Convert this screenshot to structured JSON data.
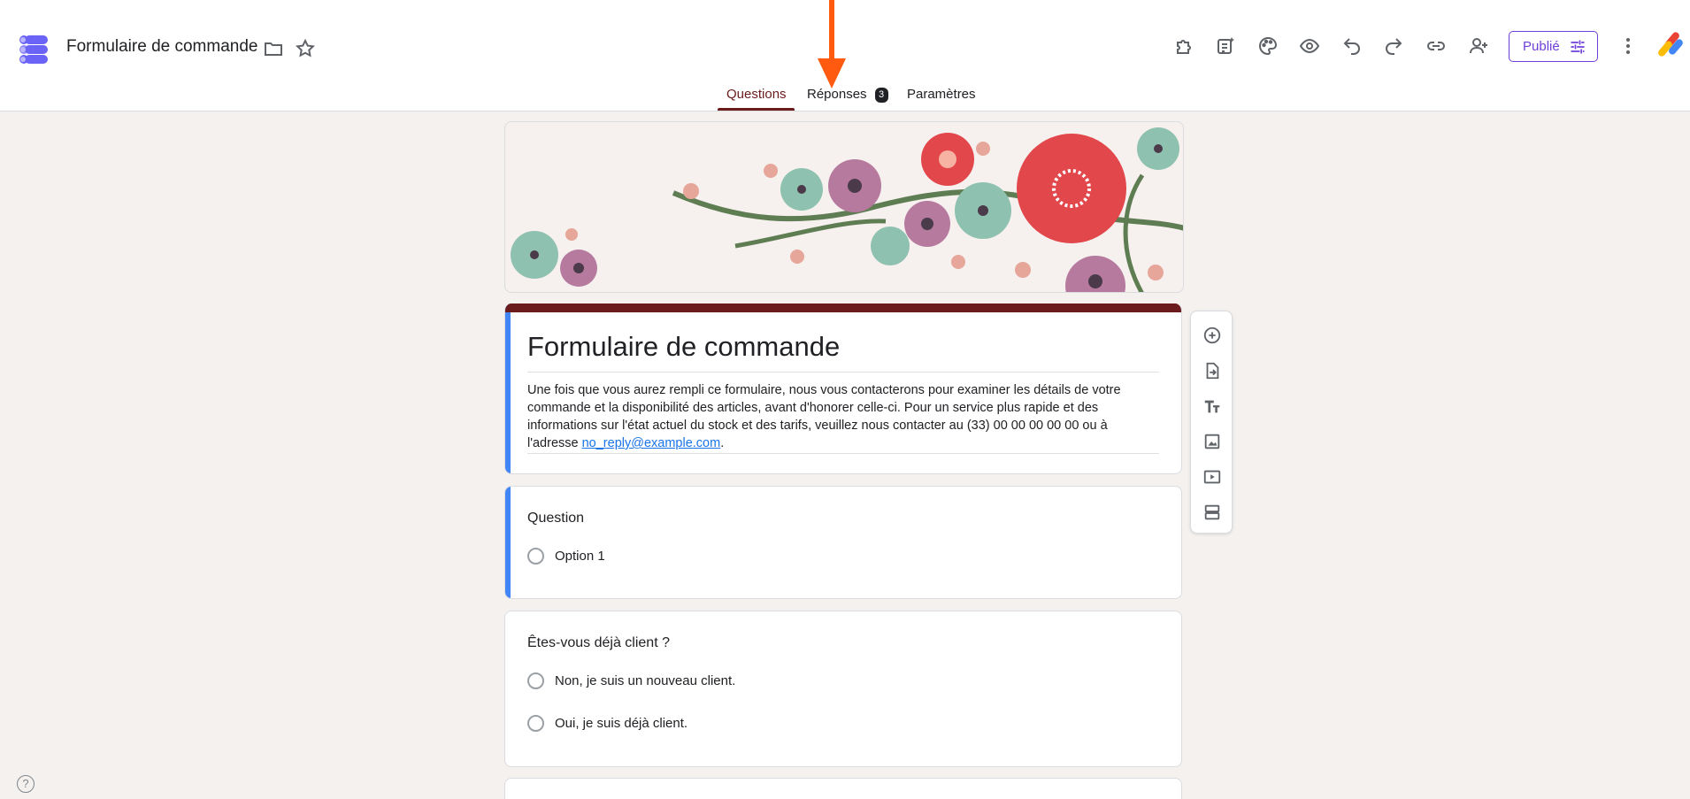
{
  "header": {
    "title": "Formulaire de commande",
    "publish_label": "Publié",
    "tabs": [
      {
        "label": "Questions",
        "active": true
      },
      {
        "label": "Réponses",
        "badge": "3",
        "active": false
      },
      {
        "label": "Paramètres",
        "active": false
      }
    ],
    "icons": [
      "folder-icon",
      "star-icon",
      "addons-icon",
      "ai-summary-icon",
      "palette-icon",
      "preview-icon",
      "undo-icon",
      "redo-icon",
      "link-icon",
      "add-person-icon",
      "more-vert-icon"
    ]
  },
  "form": {
    "title": "Formulaire de commande",
    "description_text": "Une fois que vous aurez rempli ce formulaire, nous vous contacterons pour examiner les détails de votre commande et la disponibilité des articles, avant d'honorer celle-ci. Pour un service plus rapide et des informations sur l'état actuel du stock et des tarifs, veuillez nous contacter au (33) 00 00 00 00 00 ou à l'adresse ",
    "description_link": "no_reply@example.com",
    "description_end": "."
  },
  "questions": [
    {
      "title": "Question",
      "options": [
        "Option 1"
      ]
    },
    {
      "title": "Êtes-vous déjà client ?",
      "options": [
        "Non, je suis un nouveau client.",
        "Oui, je suis déjà client."
      ]
    }
  ],
  "toolbar": [
    "add-question-icon",
    "import-questions-icon",
    "add-title-icon",
    "add-image-icon",
    "add-video-icon",
    "add-section-icon"
  ],
  "help_label": "?",
  "colors": {
    "accent": "#6b1b1b",
    "focus": "#4285f4",
    "publish": "#6f3fd9",
    "annotation_arrow": "#ff5a0f"
  }
}
